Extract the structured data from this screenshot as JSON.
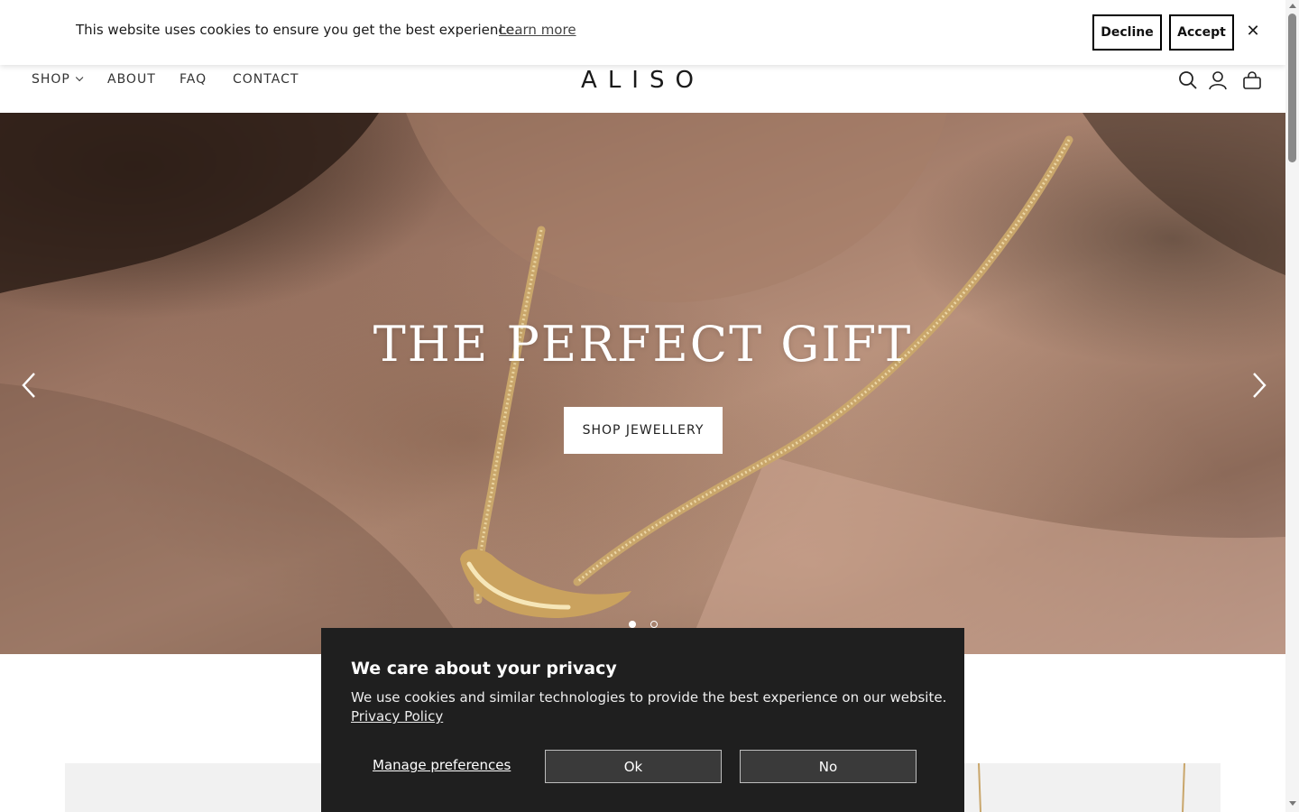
{
  "cookie_bar": {
    "message": "This website uses cookies to ensure you get the best experience.",
    "learn_more": "Learn more",
    "decline": "Decline",
    "accept": "Accept",
    "close": "✕"
  },
  "header": {
    "nav": [
      {
        "label": "SHOP"
      },
      {
        "label": "ABOUT"
      },
      {
        "label": "FAQ"
      },
      {
        "label": "CONTACT"
      }
    ],
    "logo": "ALISO",
    "icons": [
      "search-icon",
      "account-icon",
      "bag-icon"
    ]
  },
  "hero": {
    "title": "THE PERFECT GIFT",
    "cta": "SHOP JEWELLERY",
    "slide_count": 2,
    "active_slide": 1
  },
  "privacy": {
    "title": "We care about your privacy",
    "text": "We use cookies and similar technologies to provide the best experience on our website.",
    "policy_link": "Privacy Policy",
    "manage": "Manage preferences",
    "ok": "Ok",
    "no": "No"
  },
  "colors": {
    "privacy_bg": "#1f1f1f",
    "button_dark": "#3a3a3a",
    "text": "#1a1a1a"
  }
}
